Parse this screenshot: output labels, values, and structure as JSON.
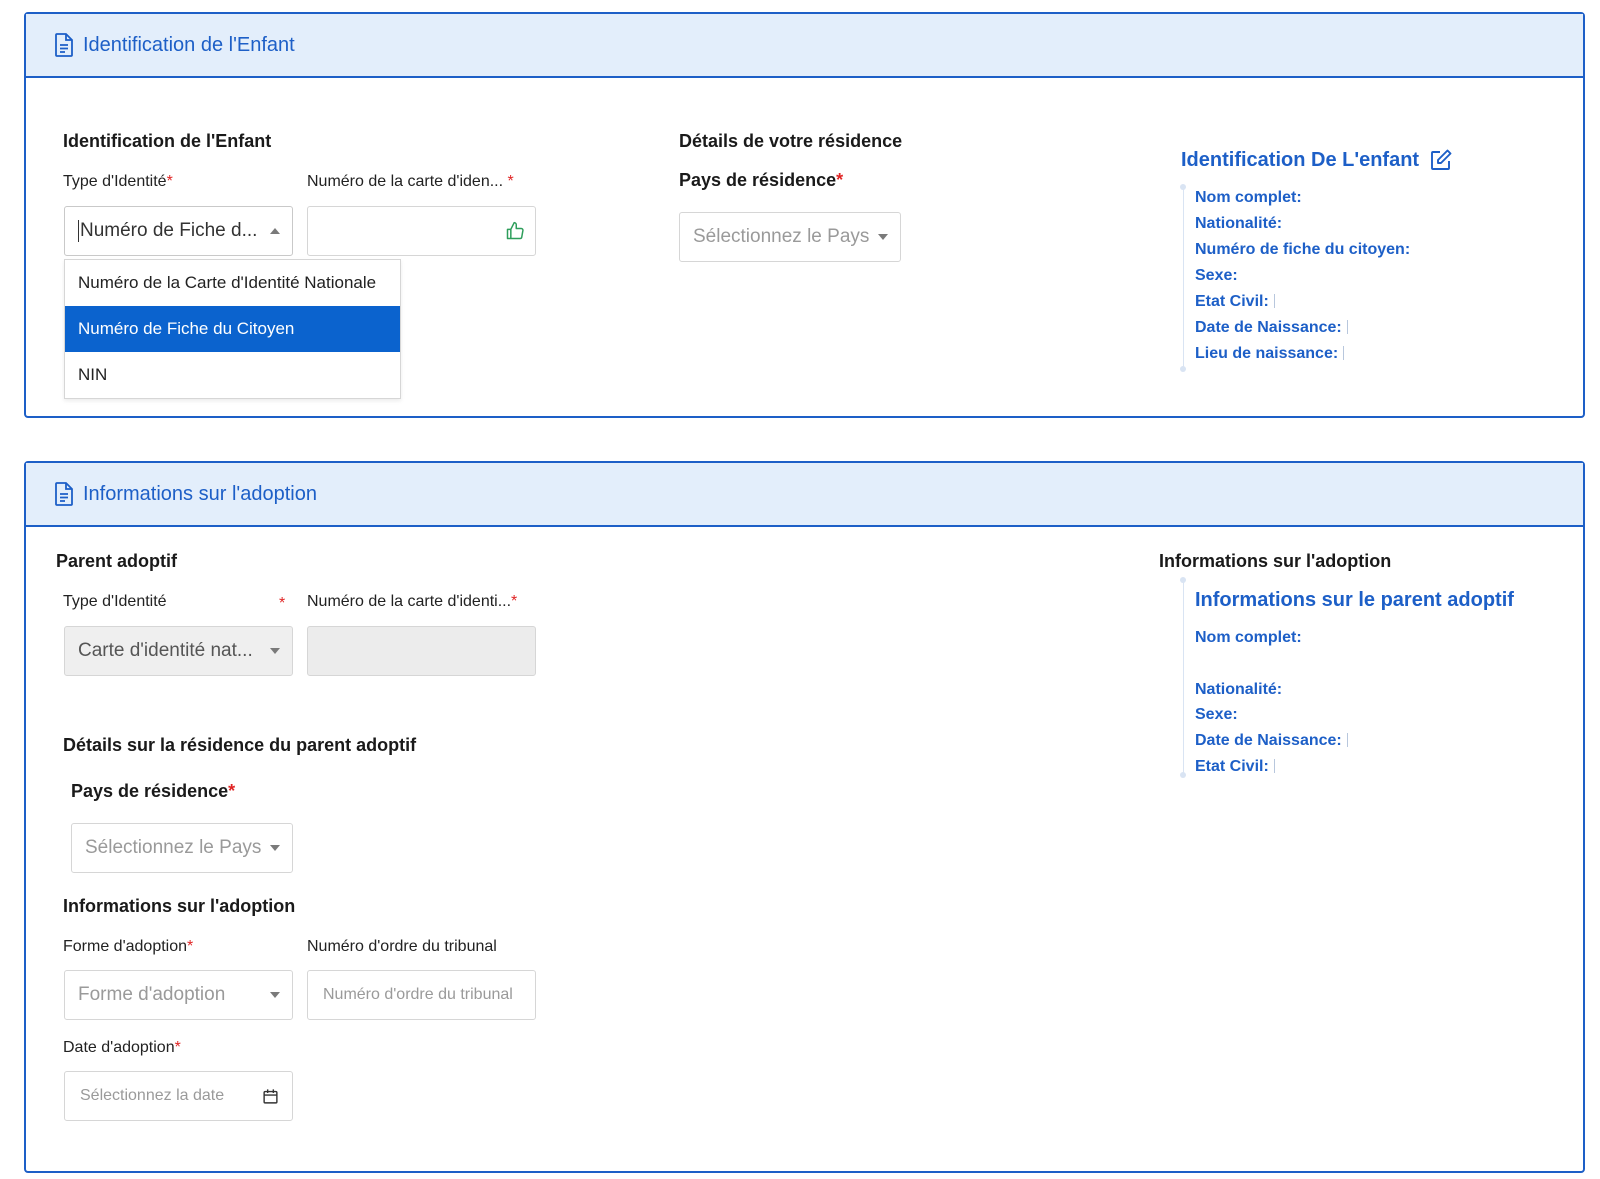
{
  "section1": {
    "header_title": "Identification de l'Enfant",
    "form_heading": "Identification de l'Enfant",
    "identity_type_label": "Type d'Identité",
    "identity_type_value": "Numéro de Fiche d...",
    "card_number_label": "Numéro de la carte d'iden...",
    "required_mark": "*",
    "dropdown_options": [
      {
        "label": "Numéro de la Carte d'Identité Nationale",
        "selected": false
      },
      {
        "label": "Numéro de Fiche du Citoyen",
        "selected": true
      },
      {
        "label": "NIN",
        "selected": false
      }
    ],
    "residence_heading": "Détails de votre résidence",
    "residence_country_label": "Pays de résidence",
    "residence_country_placeholder": "Sélectionnez le Pays",
    "summary": {
      "title": "Identification De L'enfant",
      "fields": [
        "Nom complet:",
        "Nationalité:",
        "Numéro de fiche du citoyen:",
        "Sexe:",
        "Etat Civil:",
        "Date de Naissance:",
        "Lieu de naissance:"
      ]
    }
  },
  "section2": {
    "header_title": "Informations sur l'adoption",
    "parent_heading": "Parent adoptif",
    "identity_type_label": "Type d'Identité",
    "identity_type_value": "Carte d'identité nat...",
    "card_number_label": "Numéro de la carte d'identi...",
    "residence_heading": "Détails sur la résidence du parent adoptif",
    "residence_country_label": "Pays de résidence",
    "residence_country_placeholder": "Sélectionnez le Pays",
    "adoption_heading": "Informations sur l'adoption",
    "adoption_form_label": "Forme d'adoption",
    "adoption_form_placeholder": "Forme d'adoption",
    "tribunal_label": "Numéro d'ordre du tribunal",
    "tribunal_placeholder": "Numéro d'ordre du tribunal",
    "adoption_date_label": "Date d'adoption",
    "adoption_date_placeholder": "Sélectionnez la date",
    "summary": {
      "heading": "Informations sur l'adoption",
      "title": "Informations sur le parent adoptif",
      "fields": [
        "Nom complet:",
        "Nationalité:",
        "Sexe:",
        "Date de Naissance:",
        "Etat Civil:"
      ]
    }
  },
  "colors": {
    "accent": "#1d5fc7",
    "header_bg": "#e3eefb",
    "selected_option": "#0b63ce",
    "required": "#e02424",
    "valid_icon": "#2e9e5b"
  }
}
